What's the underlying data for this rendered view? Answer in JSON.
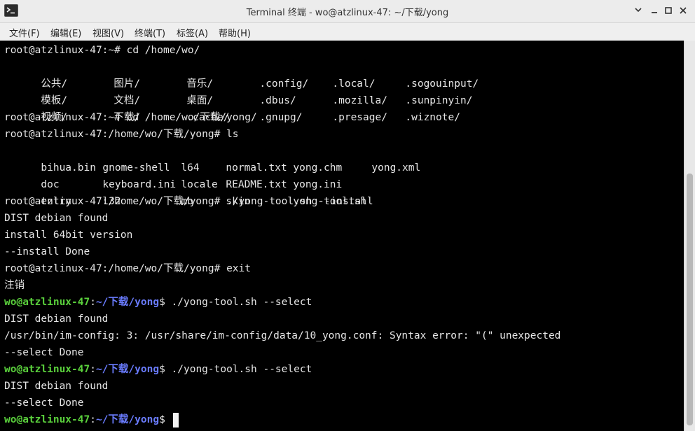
{
  "window": {
    "title": "Terminal 终端 - wo@atzlinux-47: ~/下载/yong",
    "app_icon": "terminal-icon",
    "controls": [
      "chevron-down-icon",
      "minimize-icon",
      "maximize-icon",
      "close-icon"
    ]
  },
  "menu": {
    "file": "文件(F)",
    "edit": "编辑(E)",
    "view": "视图(V)",
    "terminal": "终端(T)",
    "tabs": "标签(A)",
    "help": "帮助(H)"
  },
  "colors": {
    "user_host": "#5ad03c",
    "path": "#6a7cff",
    "text": "#e6e6e6",
    "background": "#000000"
  },
  "terminal": {
    "l1": "root@atzlinux-47:~# cd /home/wo/",
    "l2": [
      "公共/",
      "图片/",
      "音乐/",
      ".config/",
      ".local/",
      ".sogouinput/"
    ],
    "l3": [
      "模板/",
      "文档/",
      "桌面/",
      ".dbus/",
      ".mozilla/",
      ".sunpinyin/"
    ],
    "l4": [
      "视频/",
      "下载/",
      ".cache/",
      ".gnupg/",
      ".presage/",
      ".wiznote/"
    ],
    "l5": "root@atzlinux-47:~# cd /home/wo/下载/yong/",
    "l6": "root@atzlinux-47:/home/wo/下载/yong# ls",
    "l7": [
      "bihua.bin",
      "gnome-shell",
      "l64",
      "normal.txt",
      "yong.chm",
      "yong.xml"
    ],
    "l8": [
      "doc",
      "keyboard.ini",
      "locale",
      "README.txt",
      "yong.ini"
    ],
    "l9": [
      "entry",
      "l32",
      "mb",
      "skin",
      "yong-tool.sh"
    ],
    "l10": "root@atzlinux-47:/home/wo/下载/yong# ./yong-tool.sh --install",
    "l11": "DIST debian found",
    "l12": "install 64bit version",
    "l13": "--install Done",
    "l14": "root@atzlinux-47:/home/wo/下载/yong# exit",
    "l15": "注销",
    "p16": {
      "user": "wo@atzlinux-47",
      "sep": ":",
      "path": "~/下载/yong",
      "cmd": "$ ./yong-tool.sh --select"
    },
    "l17": "DIST debian found",
    "l18": "/usr/bin/im-config: 3: /usr/share/im-config/data/10_yong.conf: Syntax error: \"(\" unexpected",
    "l19": "--select Done",
    "p20": {
      "user": "wo@atzlinux-47",
      "sep": ":",
      "path": "~/下载/yong",
      "cmd": "$ ./yong-tool.sh --select"
    },
    "l21": "DIST debian found",
    "l22": "--select Done",
    "p23": {
      "user": "wo@atzlinux-47",
      "sep": ":",
      "path": "~/下载/yong",
      "cmd": "$ "
    }
  }
}
